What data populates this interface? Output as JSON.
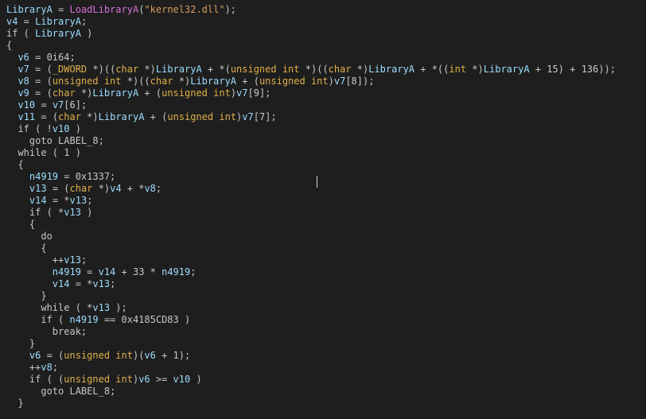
{
  "colors": {
    "background": "#1e1e1e",
    "plain": "#c8c8c8",
    "variable": "#9cdcfe",
    "function": "#d670d6",
    "type": "#e0b14a",
    "string": "#d69d5e"
  },
  "code_lines": [
    [
      [
        "v",
        "LibraryA"
      ],
      [
        "p",
        " = "
      ],
      [
        "f",
        "LoadLibraryA"
      ],
      [
        "p",
        "("
      ],
      [
        "s",
        "\"kernel32.dll\""
      ],
      [
        "p",
        ");"
      ]
    ],
    [
      [
        "v",
        "v4"
      ],
      [
        "p",
        " = "
      ],
      [
        "v",
        "LibraryA"
      ],
      [
        "p",
        ";"
      ]
    ],
    [
      [
        "p",
        "if ( "
      ],
      [
        "v",
        "LibraryA"
      ],
      [
        "p",
        " )"
      ]
    ],
    [
      [
        "p",
        "{"
      ]
    ],
    [
      [
        "p",
        "  "
      ],
      [
        "v",
        "v6"
      ],
      [
        "p",
        " = 0i64;"
      ]
    ],
    [
      [
        "p",
        "  "
      ],
      [
        "v",
        "v7"
      ],
      [
        "p",
        " = ("
      ],
      [
        "t",
        "_DWORD"
      ],
      [
        "p",
        " *)(("
      ],
      [
        "t",
        "char"
      ],
      [
        "p",
        " *)"
      ],
      [
        "v",
        "LibraryA"
      ],
      [
        "p",
        " + *("
      ],
      [
        "t",
        "unsigned int"
      ],
      [
        "p",
        " *)(("
      ],
      [
        "t",
        "char"
      ],
      [
        "p",
        " *)"
      ],
      [
        "v",
        "LibraryA"
      ],
      [
        "p",
        " + *(("
      ],
      [
        "t",
        "int"
      ],
      [
        "p",
        " *)"
      ],
      [
        "v",
        "LibraryA"
      ],
      [
        "p",
        " + 15) + 136));"
      ]
    ],
    [
      [
        "p",
        "  "
      ],
      [
        "v",
        "v8"
      ],
      [
        "p",
        " = ("
      ],
      [
        "t",
        "unsigned int"
      ],
      [
        "p",
        " *)(("
      ],
      [
        "t",
        "char"
      ],
      [
        "p",
        " *)"
      ],
      [
        "v",
        "LibraryA"
      ],
      [
        "p",
        " + ("
      ],
      [
        "t",
        "unsigned int"
      ],
      [
        "p",
        ")"
      ],
      [
        "v",
        "v7"
      ],
      [
        "p",
        "[8]);"
      ]
    ],
    [
      [
        "p",
        "  "
      ],
      [
        "v",
        "v9"
      ],
      [
        "p",
        " = ("
      ],
      [
        "t",
        "char"
      ],
      [
        "p",
        " *)"
      ],
      [
        "v",
        "LibraryA"
      ],
      [
        "p",
        " + ("
      ],
      [
        "t",
        "unsigned int"
      ],
      [
        "p",
        ")"
      ],
      [
        "v",
        "v7"
      ],
      [
        "p",
        "[9];"
      ]
    ],
    [
      [
        "p",
        "  "
      ],
      [
        "v",
        "v10"
      ],
      [
        "p",
        " = "
      ],
      [
        "v",
        "v7"
      ],
      [
        "p",
        "[6];"
      ]
    ],
    [
      [
        "p",
        "  "
      ],
      [
        "v",
        "v11"
      ],
      [
        "p",
        " = ("
      ],
      [
        "t",
        "char"
      ],
      [
        "p",
        " *)"
      ],
      [
        "v",
        "LibraryA"
      ],
      [
        "p",
        " + ("
      ],
      [
        "t",
        "unsigned int"
      ],
      [
        "p",
        ")"
      ],
      [
        "v",
        "v7"
      ],
      [
        "p",
        "[7];"
      ]
    ],
    [
      [
        "p",
        "  if ( !"
      ],
      [
        "v",
        "v10"
      ],
      [
        "p",
        " )"
      ]
    ],
    [
      [
        "p",
        "    goto LABEL_8;"
      ]
    ],
    [
      [
        "p",
        "  while ( 1 )"
      ]
    ],
    [
      [
        "p",
        "  {"
      ]
    ],
    [
      [
        "p",
        "    "
      ],
      [
        "v",
        "n4919"
      ],
      [
        "p",
        " = 0x1337;"
      ]
    ],
    [
      [
        "p",
        "    "
      ],
      [
        "v",
        "v13"
      ],
      [
        "p",
        " = ("
      ],
      [
        "t",
        "char"
      ],
      [
        "p",
        " *)"
      ],
      [
        "v",
        "v4"
      ],
      [
        "p",
        " + *"
      ],
      [
        "v",
        "v8"
      ],
      [
        "p",
        ";"
      ]
    ],
    [
      [
        "p",
        "    "
      ],
      [
        "v",
        "v14"
      ],
      [
        "p",
        " = *"
      ],
      [
        "v",
        "v13"
      ],
      [
        "p",
        ";"
      ]
    ],
    [
      [
        "p",
        "    if ( *"
      ],
      [
        "v",
        "v13"
      ],
      [
        "p",
        " )"
      ]
    ],
    [
      [
        "p",
        "    {"
      ]
    ],
    [
      [
        "p",
        "      do"
      ]
    ],
    [
      [
        "p",
        "      {"
      ]
    ],
    [
      [
        "p",
        "        ++"
      ],
      [
        "v",
        "v13"
      ],
      [
        "p",
        ";"
      ]
    ],
    [
      [
        "p",
        "        "
      ],
      [
        "v",
        "n4919"
      ],
      [
        "p",
        " = "
      ],
      [
        "v",
        "v14"
      ],
      [
        "p",
        " + 33 * "
      ],
      [
        "v",
        "n4919"
      ],
      [
        "p",
        ";"
      ]
    ],
    [
      [
        "p",
        "        "
      ],
      [
        "v",
        "v14"
      ],
      [
        "p",
        " = *"
      ],
      [
        "v",
        "v13"
      ],
      [
        "p",
        ";"
      ]
    ],
    [
      [
        "p",
        "      }"
      ]
    ],
    [
      [
        "p",
        "      while ( *"
      ],
      [
        "v",
        "v13"
      ],
      [
        "p",
        " );"
      ]
    ],
    [
      [
        "p",
        "      if ( "
      ],
      [
        "v",
        "n4919"
      ],
      [
        "p",
        " == 0x4185CD83 )"
      ]
    ],
    [
      [
        "p",
        "        break;"
      ]
    ],
    [
      [
        "p",
        "    }"
      ]
    ],
    [
      [
        "p",
        "    "
      ],
      [
        "v",
        "v6"
      ],
      [
        "p",
        " = ("
      ],
      [
        "t",
        "unsigned int"
      ],
      [
        "p",
        ")("
      ],
      [
        "v",
        "v6"
      ],
      [
        "p",
        " + 1);"
      ]
    ],
    [
      [
        "p",
        "    ++"
      ],
      [
        "v",
        "v8"
      ],
      [
        "p",
        ";"
      ]
    ],
    [
      [
        "p",
        "    if ( ("
      ],
      [
        "t",
        "unsigned int"
      ],
      [
        "p",
        ")"
      ],
      [
        "v",
        "v6"
      ],
      [
        "p",
        " >= "
      ],
      [
        "v",
        "v10"
      ],
      [
        "p",
        " )"
      ]
    ],
    [
      [
        "p",
        "      goto LABEL_8;"
      ]
    ],
    [
      [
        "p",
        "  }"
      ]
    ]
  ]
}
